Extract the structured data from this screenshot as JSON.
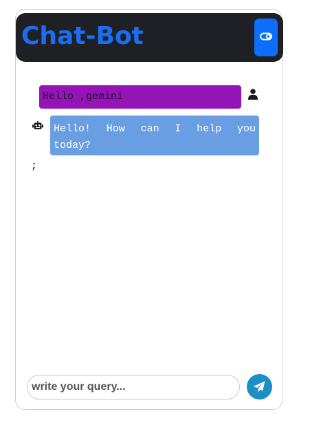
{
  "header": {
    "title": "Chat-Bot",
    "title_color": "#1a6ef5",
    "background": "#1f2026",
    "toggle_icon": "toggle-icon",
    "toggle_color": "#0d6efd"
  },
  "messages": [
    {
      "role": "user",
      "text": "Hello ,gemini",
      "icon": "user-icon",
      "bubble_color": "#9414b8"
    },
    {
      "role": "bot",
      "text": "Hello! How can I help you today?",
      "icon": "robot-icon",
      "bubble_color": "#6a9ee3"
    }
  ],
  "stray_text": ";",
  "composer": {
    "placeholder": "write your query...",
    "value": "",
    "send_icon": "send-icon",
    "send_color": "#1c8fc4"
  }
}
